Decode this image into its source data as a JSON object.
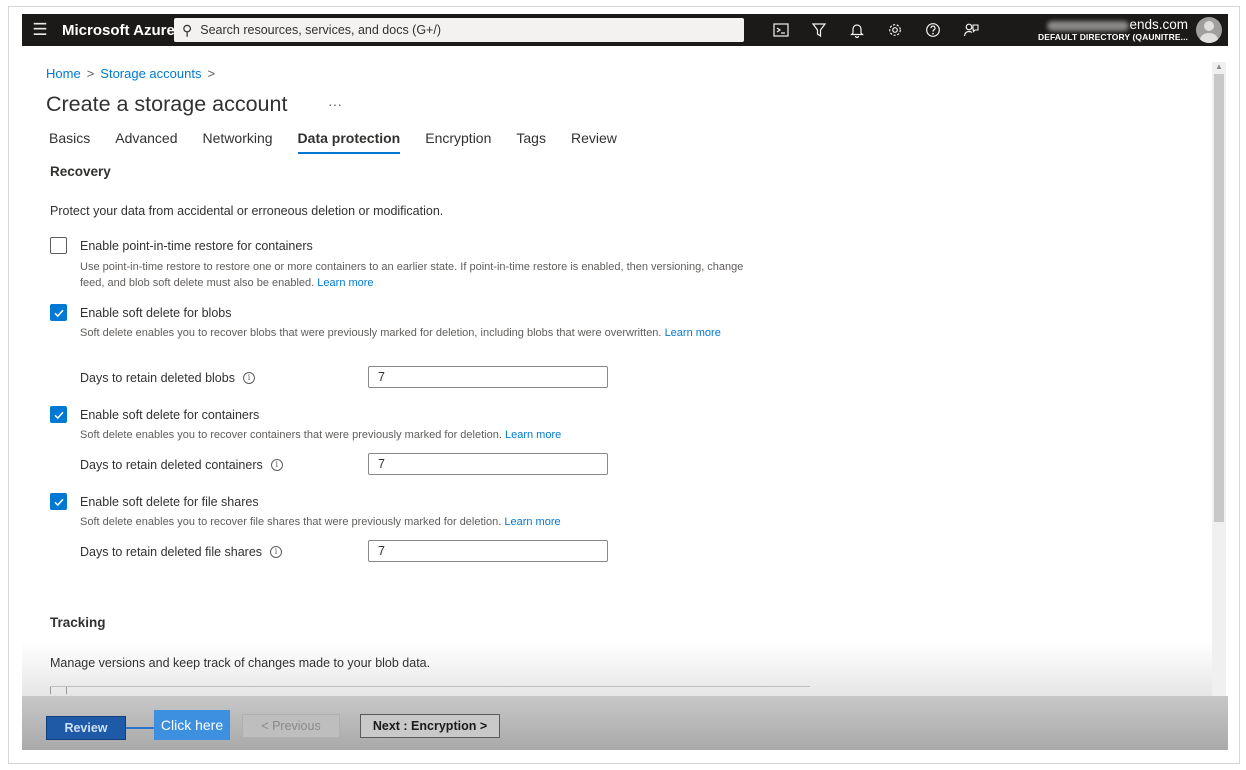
{
  "topbar": {
    "menu_icon": "hamburger-menu-icon",
    "brand": "Microsoft Azure",
    "search_placeholder": "Search resources, services, and docs (G+/)",
    "icons": [
      "cloud-shell-icon",
      "directory-filter-icon",
      "notifications-bell-icon",
      "settings-gear-icon",
      "help-question-icon",
      "feedback-icon"
    ],
    "account_email_visible": "ends.com",
    "account_directory": "DEFAULT DIRECTORY (QAUNITRE..."
  },
  "breadcrumb": {
    "home": "Home",
    "storage": "Storage accounts",
    "sep": ">"
  },
  "page": {
    "title": "Create a storage account",
    "more": "···"
  },
  "tabs": [
    {
      "label": "Basics",
      "active": false
    },
    {
      "label": "Advanced",
      "active": false
    },
    {
      "label": "Networking",
      "active": false
    },
    {
      "label": "Data protection",
      "active": true
    },
    {
      "label": "Encryption",
      "active": false
    },
    {
      "label": "Tags",
      "active": false
    },
    {
      "label": "Review",
      "active": false
    }
  ],
  "recovery": {
    "title": "Recovery",
    "description": "Protect your data from accidental or erroneous deletion or modification.",
    "pitr": {
      "label": "Enable point-in-time restore for containers",
      "checked": false,
      "help": "Use point-in-time restore to restore one or more containers to an earlier state. If point-in-time restore is enabled, then versioning, change feed, and blob soft delete must also be enabled.",
      "link": "Learn more"
    },
    "blobs": {
      "label": "Enable soft delete for blobs",
      "checked": true,
      "help": "Soft delete enables you to recover blobs that were previously marked for deletion, including blobs that were overwritten.",
      "link": "Learn more",
      "days_label": "Days to retain deleted blobs",
      "days_value": "7"
    },
    "containers": {
      "label": "Enable soft delete for containers",
      "checked": true,
      "help": "Soft delete enables you to recover containers that were previously marked for deletion.",
      "link": "Learn more",
      "days_label": "Days to retain deleted containers",
      "days_value": "7"
    },
    "fileshares": {
      "label": "Enable soft delete for file shares",
      "checked": true,
      "help": "Soft delete enables you to recover file shares that were previously marked for deletion.",
      "link": "Learn more",
      "days_label": "Days to retain deleted file shares",
      "days_value": "7"
    }
  },
  "tracking": {
    "title": "Tracking",
    "description": "Manage versions and keep track of changes made to your blob data."
  },
  "footer": {
    "review": "Review",
    "callout": "Click here",
    "previous": "< Previous",
    "next": "Next : Encryption >"
  },
  "colors": {
    "accent": "#0078d4",
    "topbar_bg": "#1b1a19",
    "callout_bg": "#3d8fe0"
  }
}
